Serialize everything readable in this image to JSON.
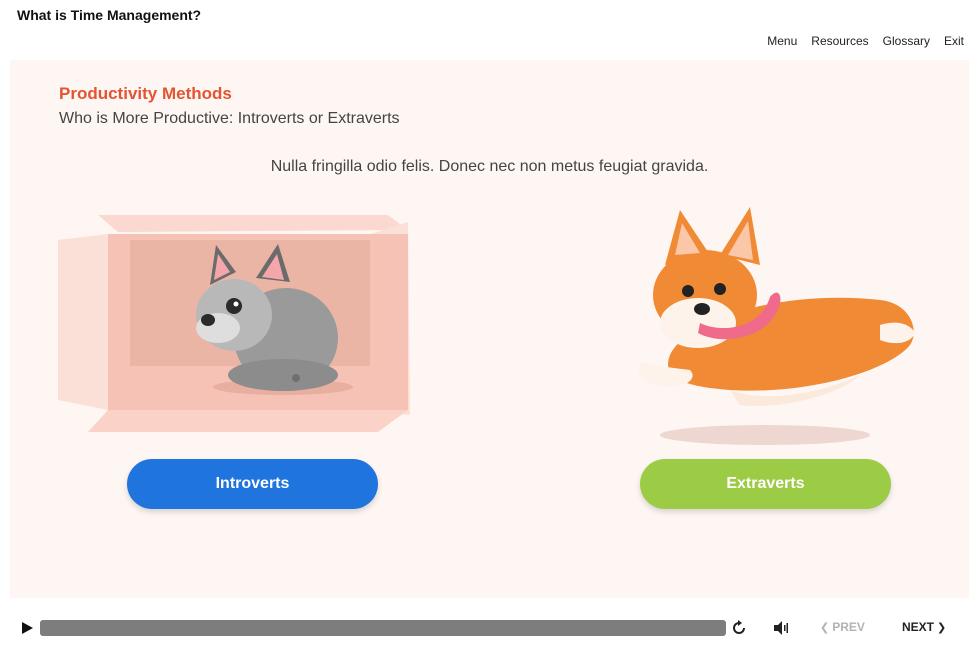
{
  "header": {
    "title": "What is Time Management?"
  },
  "nav": {
    "menu": "Menu",
    "resources": "Resources",
    "glossary": "Glossary",
    "exit": "Exit"
  },
  "slide": {
    "heading": "Productivity Methods",
    "subheading": "Who is More Productive: Introverts or Extraverts",
    "body": "Nulla fringilla odio felis. Donec nec non metus feugiat gravida.",
    "choices": [
      {
        "label": "Introverts",
        "color": "#1f74dd",
        "image": "french-bulldog-in-box"
      },
      {
        "label": "Extraverts",
        "color": "#9ccb46",
        "image": "running-corgi"
      }
    ]
  },
  "player": {
    "prev_label": "PREV",
    "next_label": "NEXT",
    "icons": [
      "play-icon",
      "replay-icon",
      "volume-icon",
      "chevron-left-icon",
      "chevron-right-icon"
    ]
  },
  "colors": {
    "accent": "#e45332",
    "slide_bg": "#fef6f3"
  }
}
